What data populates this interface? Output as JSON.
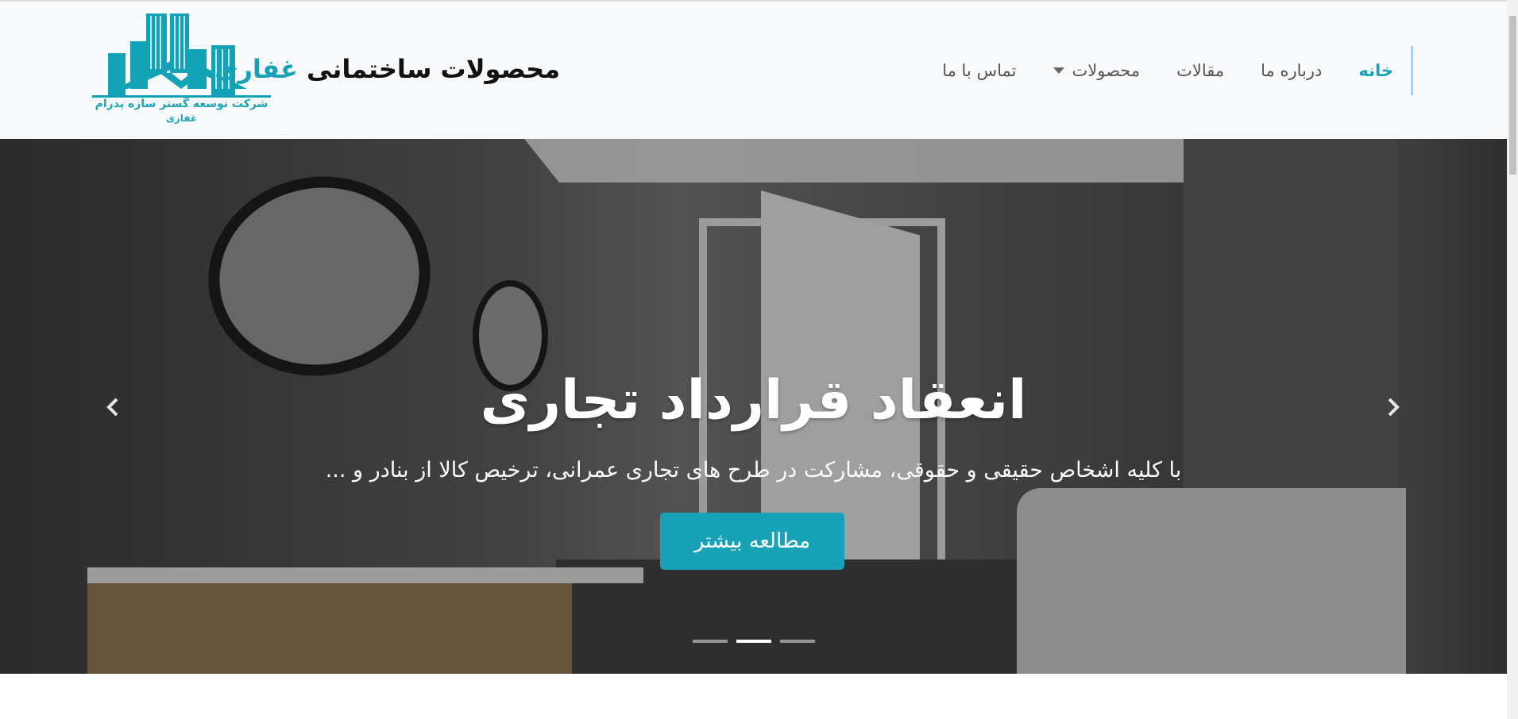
{
  "header": {
    "logo": {
      "tagline": "شرکت توسعه گستر سازه پدرام",
      "tagline2": "غفاری"
    },
    "brand": {
      "text": "محصولات ساختمانی",
      "highlight": "غفاری"
    },
    "nav": [
      {
        "label": "خانه",
        "active": true
      },
      {
        "label": "درباره ما"
      },
      {
        "label": "مقالات"
      },
      {
        "label": "محصولات",
        "dropdown": true
      },
      {
        "label": "تماس با ما"
      }
    ]
  },
  "hero": {
    "title": "انعقاد قرارداد تجاری",
    "subtitle": "با کلیه اشخاص حقیقی و حقوقی، مشارکت در طرح های تجاری عمرانی، ترخیص کالا از بنادر و ...",
    "button": "مطالعه بیشتر",
    "slides": 3,
    "active_slide": 2
  },
  "colors": {
    "accent": "#17a2b8",
    "header_bg": "#f8f9fa"
  }
}
